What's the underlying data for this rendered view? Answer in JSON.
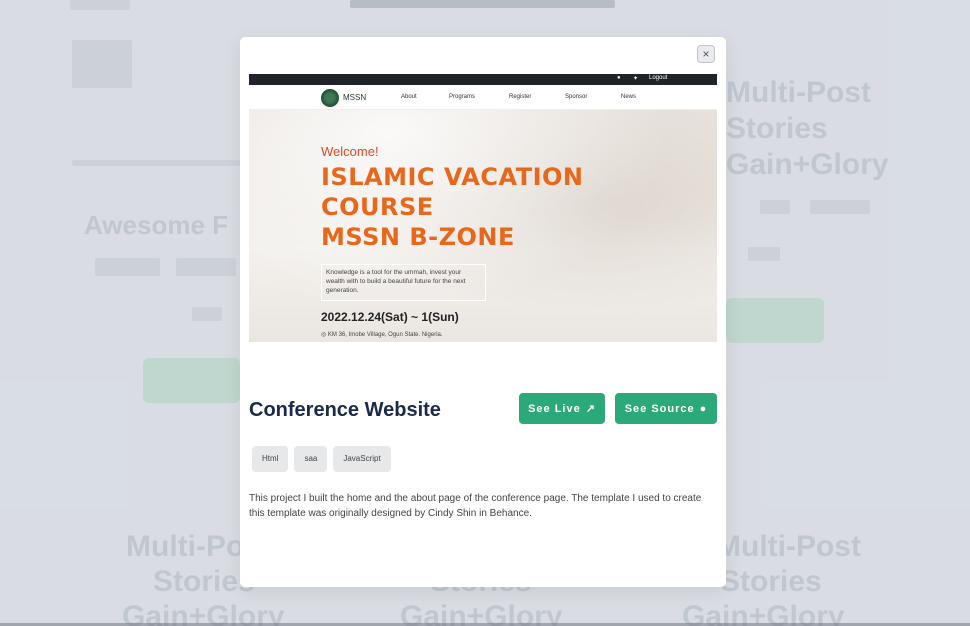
{
  "modal": {
    "close_label": "×",
    "project_title": "Conference Website",
    "see_live_label": "See Live",
    "see_source_label": "See Source",
    "tags": [
      "Html",
      "saa",
      "JavaScript"
    ],
    "description": "This project I built the home and the about page of the conference page. The template I used to create this template was originally designed by Cindy Shin in Behance."
  },
  "preview": {
    "logout": "Logout",
    "logo_text": "MSSN",
    "nav": [
      "About",
      "Programs",
      "Register",
      "Sponsor",
      "News"
    ],
    "welcome": "Welcome!",
    "title_line1": "ISLAMIC VACATION",
    "title_line2": "COURSE",
    "title_line3": "MSSN B-ZONE",
    "box_text": "Knowledge is a tool for the ummah, invest your wealth with to build a beautiful future for the next generation.",
    "date": "2022.12.24(Sat) ~ 1(Sun)",
    "location": "KM 36, Imobe Village, Ogun State. Nigeria."
  },
  "background": {
    "heading_right": [
      "Multi-Post",
      "Stories",
      "Gain+Glory"
    ],
    "heading_left_partial": "Awesome F",
    "bottom_headings": [
      "Multi-Po",
      "Stories",
      "Gain+Glory",
      "Stories",
      "Gain+Glory",
      "Multi-Post",
      "Stories",
      "Gain+Glory"
    ]
  },
  "colors": {
    "accent": "#2ba978",
    "title": "#1b2a4a",
    "hero_orange": "#e8671a"
  }
}
